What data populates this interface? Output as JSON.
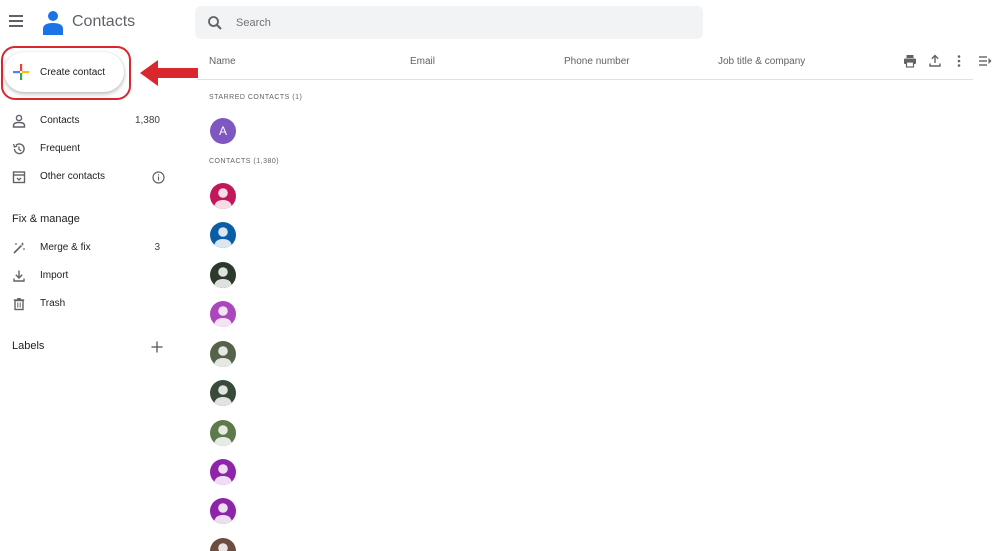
{
  "header": {
    "app_title": "Contacts",
    "menu_icon": "menu-icon",
    "logo_icon": "contacts-logo-icon",
    "search_placeholder": "Search",
    "search_icon": "search-icon"
  },
  "sidebar": {
    "create_label": "Create contact",
    "items": [
      {
        "label": "Contacts",
        "count": "1,380",
        "icon": "person-icon"
      },
      {
        "label": "Frequent",
        "count": "",
        "icon": "history-icon"
      },
      {
        "label": "Other contacts",
        "count": "",
        "icon": "archive-icon"
      }
    ],
    "fix_title": "Fix & manage",
    "fix_items": [
      {
        "label": "Merge & fix",
        "count": "3",
        "icon": "magic-wand-icon"
      },
      {
        "label": "Import",
        "count": "",
        "icon": "download-icon"
      },
      {
        "label": "Trash",
        "count": "",
        "icon": "trash-icon"
      }
    ],
    "labels_title": "Labels"
  },
  "list": {
    "columns": [
      "Name",
      "Email",
      "Phone number",
      "Job title & company"
    ],
    "starred_label": "STARRED CONTACTS (1)",
    "starred_avatar_letter": "A",
    "contacts_label": "CONTACTS (1,380)",
    "avatar_colors": [
      "#c2185b",
      "#0b5ea6",
      "#2b3a2b",
      "#ab47bc",
      "#55634a",
      "#3a4a3a",
      "#5d7a4a",
      "#8e24aa",
      "#8e24aa",
      "#6d4c41"
    ]
  },
  "colors": {
    "accent_red": "#d9272d",
    "starred_avatar": "#7e57c2"
  }
}
